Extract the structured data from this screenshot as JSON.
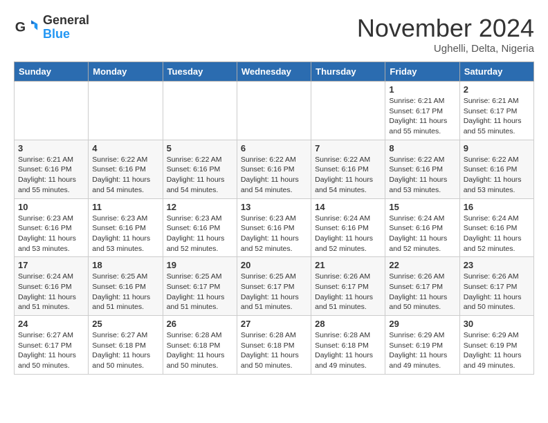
{
  "header": {
    "logo_line1": "General",
    "logo_line2": "Blue",
    "month_title": "November 2024",
    "location": "Ughelli, Delta, Nigeria"
  },
  "weekdays": [
    "Sunday",
    "Monday",
    "Tuesday",
    "Wednesday",
    "Thursday",
    "Friday",
    "Saturday"
  ],
  "weeks": [
    [
      {
        "day": "",
        "detail": ""
      },
      {
        "day": "",
        "detail": ""
      },
      {
        "day": "",
        "detail": ""
      },
      {
        "day": "",
        "detail": ""
      },
      {
        "day": "",
        "detail": ""
      },
      {
        "day": "1",
        "detail": "Sunrise: 6:21 AM\nSunset: 6:17 PM\nDaylight: 11 hours\nand 55 minutes."
      },
      {
        "day": "2",
        "detail": "Sunrise: 6:21 AM\nSunset: 6:17 PM\nDaylight: 11 hours\nand 55 minutes."
      }
    ],
    [
      {
        "day": "3",
        "detail": "Sunrise: 6:21 AM\nSunset: 6:16 PM\nDaylight: 11 hours\nand 55 minutes."
      },
      {
        "day": "4",
        "detail": "Sunrise: 6:22 AM\nSunset: 6:16 PM\nDaylight: 11 hours\nand 54 minutes."
      },
      {
        "day": "5",
        "detail": "Sunrise: 6:22 AM\nSunset: 6:16 PM\nDaylight: 11 hours\nand 54 minutes."
      },
      {
        "day": "6",
        "detail": "Sunrise: 6:22 AM\nSunset: 6:16 PM\nDaylight: 11 hours\nand 54 minutes."
      },
      {
        "day": "7",
        "detail": "Sunrise: 6:22 AM\nSunset: 6:16 PM\nDaylight: 11 hours\nand 54 minutes."
      },
      {
        "day": "8",
        "detail": "Sunrise: 6:22 AM\nSunset: 6:16 PM\nDaylight: 11 hours\nand 53 minutes."
      },
      {
        "day": "9",
        "detail": "Sunrise: 6:22 AM\nSunset: 6:16 PM\nDaylight: 11 hours\nand 53 minutes."
      }
    ],
    [
      {
        "day": "10",
        "detail": "Sunrise: 6:23 AM\nSunset: 6:16 PM\nDaylight: 11 hours\nand 53 minutes."
      },
      {
        "day": "11",
        "detail": "Sunrise: 6:23 AM\nSunset: 6:16 PM\nDaylight: 11 hours\nand 53 minutes."
      },
      {
        "day": "12",
        "detail": "Sunrise: 6:23 AM\nSunset: 6:16 PM\nDaylight: 11 hours\nand 52 minutes."
      },
      {
        "day": "13",
        "detail": "Sunrise: 6:23 AM\nSunset: 6:16 PM\nDaylight: 11 hours\nand 52 minutes."
      },
      {
        "day": "14",
        "detail": "Sunrise: 6:24 AM\nSunset: 6:16 PM\nDaylight: 11 hours\nand 52 minutes."
      },
      {
        "day": "15",
        "detail": "Sunrise: 6:24 AM\nSunset: 6:16 PM\nDaylight: 11 hours\nand 52 minutes."
      },
      {
        "day": "16",
        "detail": "Sunrise: 6:24 AM\nSunset: 6:16 PM\nDaylight: 11 hours\nand 52 minutes."
      }
    ],
    [
      {
        "day": "17",
        "detail": "Sunrise: 6:24 AM\nSunset: 6:16 PM\nDaylight: 11 hours\nand 51 minutes."
      },
      {
        "day": "18",
        "detail": "Sunrise: 6:25 AM\nSunset: 6:16 PM\nDaylight: 11 hours\nand 51 minutes."
      },
      {
        "day": "19",
        "detail": "Sunrise: 6:25 AM\nSunset: 6:17 PM\nDaylight: 11 hours\nand 51 minutes."
      },
      {
        "day": "20",
        "detail": "Sunrise: 6:25 AM\nSunset: 6:17 PM\nDaylight: 11 hours\nand 51 minutes."
      },
      {
        "day": "21",
        "detail": "Sunrise: 6:26 AM\nSunset: 6:17 PM\nDaylight: 11 hours\nand 51 minutes."
      },
      {
        "day": "22",
        "detail": "Sunrise: 6:26 AM\nSunset: 6:17 PM\nDaylight: 11 hours\nand 50 minutes."
      },
      {
        "day": "23",
        "detail": "Sunrise: 6:26 AM\nSunset: 6:17 PM\nDaylight: 11 hours\nand 50 minutes."
      }
    ],
    [
      {
        "day": "24",
        "detail": "Sunrise: 6:27 AM\nSunset: 6:17 PM\nDaylight: 11 hours\nand 50 minutes."
      },
      {
        "day": "25",
        "detail": "Sunrise: 6:27 AM\nSunset: 6:18 PM\nDaylight: 11 hours\nand 50 minutes."
      },
      {
        "day": "26",
        "detail": "Sunrise: 6:28 AM\nSunset: 6:18 PM\nDaylight: 11 hours\nand 50 minutes."
      },
      {
        "day": "27",
        "detail": "Sunrise: 6:28 AM\nSunset: 6:18 PM\nDaylight: 11 hours\nand 50 minutes."
      },
      {
        "day": "28",
        "detail": "Sunrise: 6:28 AM\nSunset: 6:18 PM\nDaylight: 11 hours\nand 49 minutes."
      },
      {
        "day": "29",
        "detail": "Sunrise: 6:29 AM\nSunset: 6:19 PM\nDaylight: 11 hours\nand 49 minutes."
      },
      {
        "day": "30",
        "detail": "Sunrise: 6:29 AM\nSunset: 6:19 PM\nDaylight: 11 hours\nand 49 minutes."
      }
    ]
  ]
}
